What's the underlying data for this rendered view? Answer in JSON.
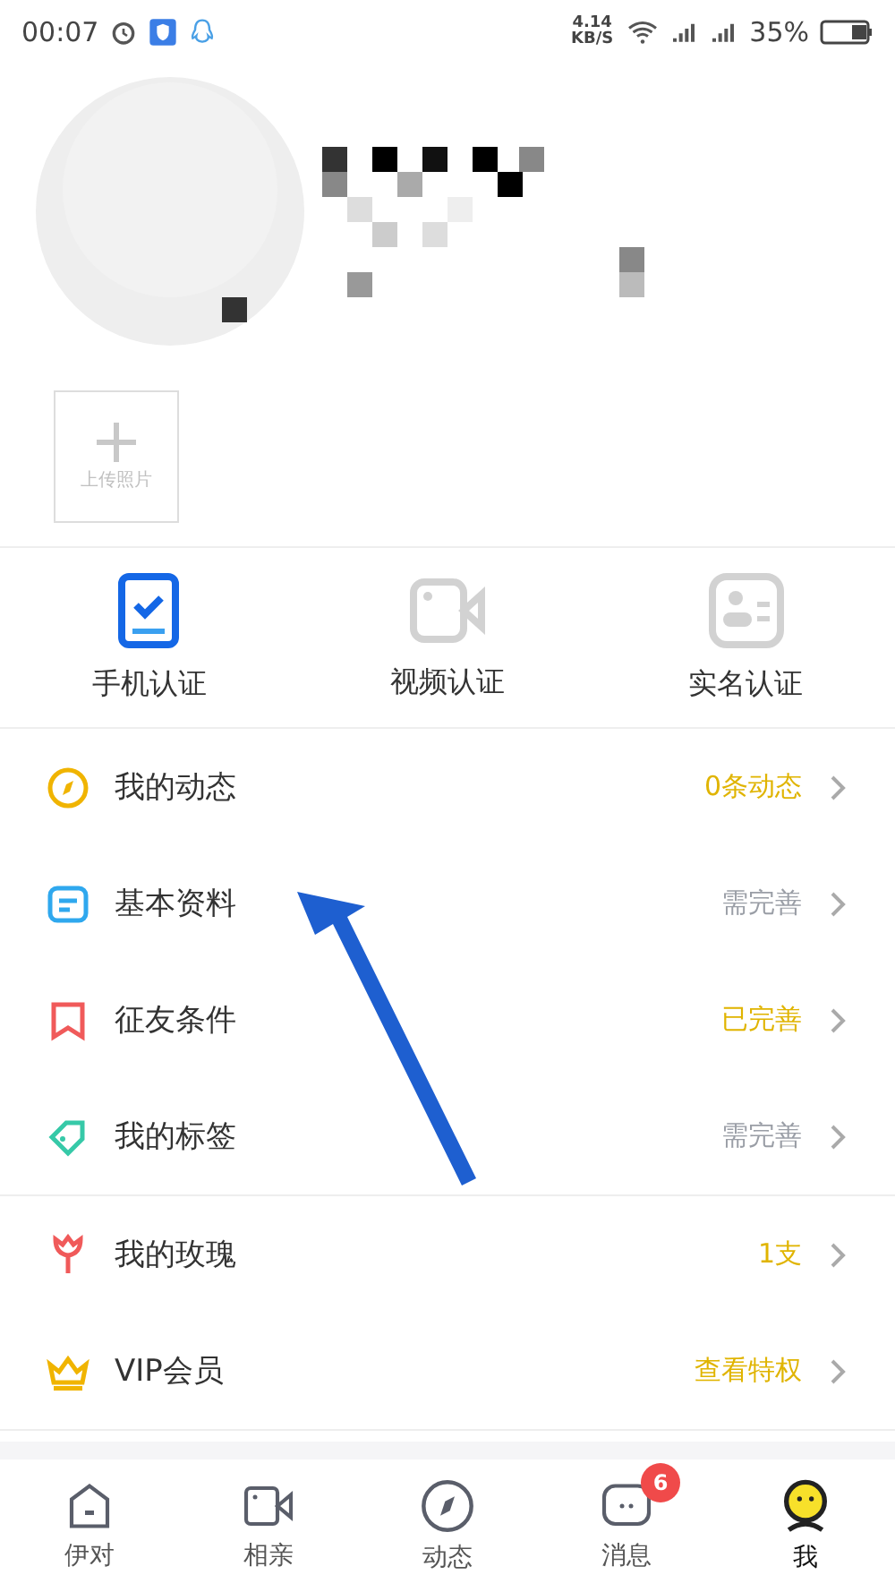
{
  "status_bar": {
    "time": "00:07",
    "speed": "4.14",
    "speed_unit": "KB/S",
    "battery": "35%"
  },
  "profile": {
    "upload_label": "上传照片"
  },
  "verifications": [
    {
      "kind": "phone",
      "label": "手机认证",
      "verified": true
    },
    {
      "kind": "video",
      "label": "视频认证",
      "verified": false
    },
    {
      "kind": "id",
      "label": "实名认证",
      "verified": false
    }
  ],
  "menu_groups": [
    [
      {
        "kind": "compass",
        "label": "我的动态",
        "value": "0条动态",
        "highlight": true
      },
      {
        "kind": "doc",
        "label": "基本资料",
        "value": "需完善",
        "highlight": false
      },
      {
        "kind": "bookmark",
        "label": "征友条件",
        "value": "已完善",
        "highlight": true
      },
      {
        "kind": "tag",
        "label": "我的标签",
        "value": "需完善",
        "highlight": false
      }
    ],
    [
      {
        "kind": "rose",
        "label": "我的玫瑰",
        "value": "1支",
        "highlight": true
      },
      {
        "kind": "crown",
        "label": "VIP会员",
        "value": "查看特权",
        "highlight": true
      }
    ]
  ],
  "nav": [
    {
      "kind": "home",
      "label": "伊对",
      "selected": false
    },
    {
      "kind": "video",
      "label": "相亲",
      "selected": false
    },
    {
      "kind": "compass",
      "label": "动态",
      "selected": false
    },
    {
      "kind": "chat",
      "label": "消息",
      "selected": false,
      "badge": "6"
    },
    {
      "kind": "me",
      "label": "我",
      "selected": true
    }
  ]
}
